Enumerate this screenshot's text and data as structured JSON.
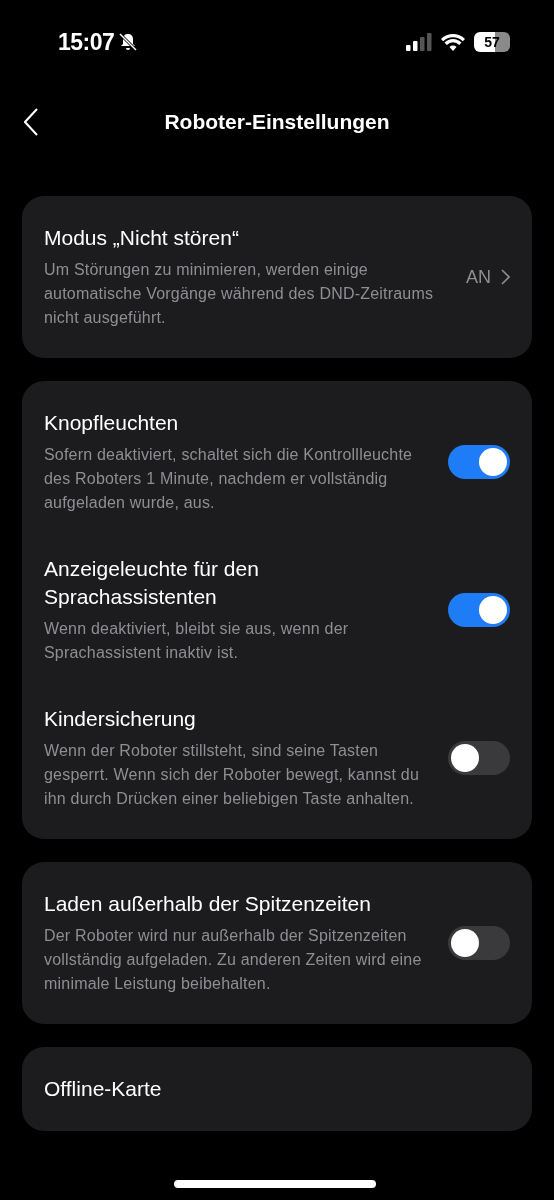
{
  "status_bar": {
    "time": "15:07",
    "silent": true,
    "battery": "57"
  },
  "header": {
    "title": "Roboter-Einstellungen"
  },
  "sections": [
    {
      "items": [
        {
          "kind": "link",
          "title": "Modus „Nicht stören“",
          "description": "Um Störungen zu minimieren, werden einige automatische Vorgänge während des DND-Zeitraums nicht ausgeführt.",
          "value": "AN"
        }
      ]
    },
    {
      "items": [
        {
          "kind": "toggle",
          "title": "Knopfleuchten",
          "description": "Sofern deaktiviert, schaltet sich die Kontrollleuchte des Roboters 1 Minute, nachdem er vollständig aufgeladen wurde, aus.",
          "on": true
        },
        {
          "kind": "toggle",
          "title": "Anzeigeleuchte für den Sprachassistenten",
          "description": "Wenn deaktiviert, bleibt sie aus, wenn der Sprachassistent inaktiv ist.",
          "on": true
        },
        {
          "kind": "toggle",
          "title": "Kindersicherung",
          "description": "Wenn der Roboter stillsteht, sind seine Tasten gesperrt. Wenn sich der Roboter bewegt, kannst du ihn durch Drücken einer beliebigen Taste anhalten.",
          "on": false
        }
      ]
    },
    {
      "items": [
        {
          "kind": "toggle",
          "title": "Laden außerhalb der Spitzenzeiten",
          "description": "Der Roboter wird nur außerhalb der Spitzenzeiten vollständig aufgeladen. Zu anderen Zeiten wird eine minimale Leistung beibehalten.",
          "on": false
        }
      ]
    },
    {
      "items": [
        {
          "kind": "plain",
          "title": "Offline-Karte"
        }
      ]
    }
  ]
}
